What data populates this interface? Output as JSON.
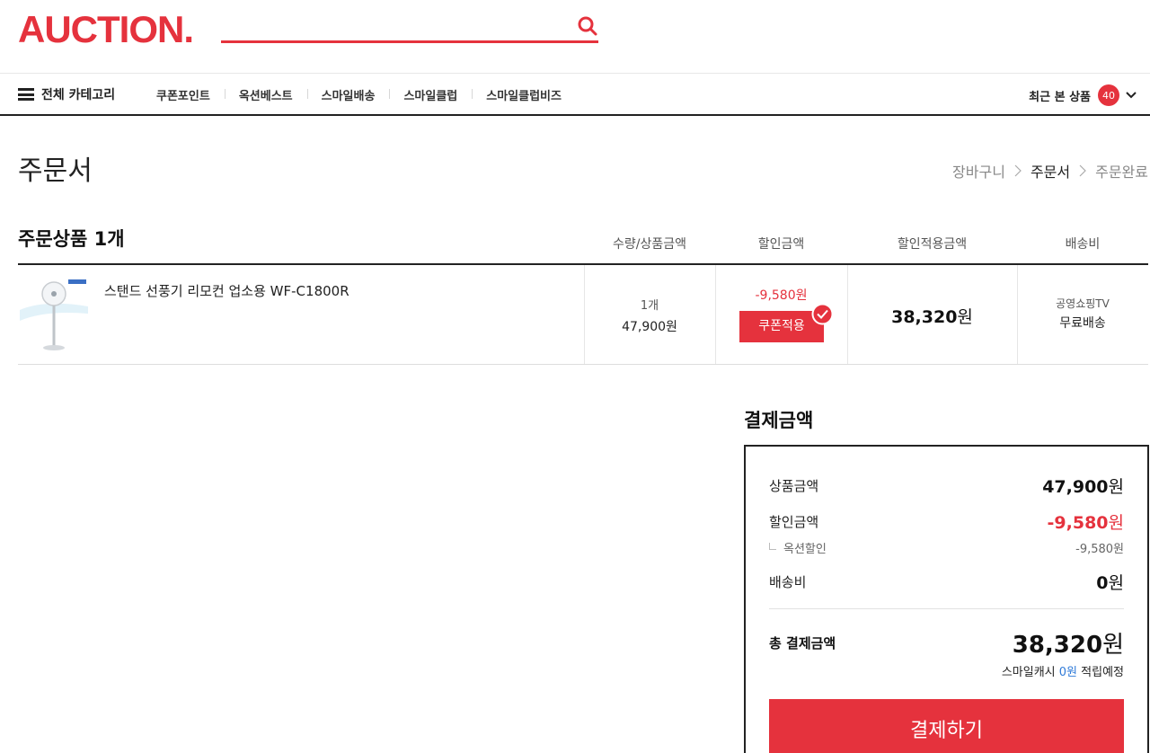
{
  "header": {
    "logo": "AUCTION.",
    "search": {
      "value": "",
      "placeholder": ""
    }
  },
  "nav": {
    "all_categories": "전체 카테고리",
    "menu": [
      "쿠폰포인트",
      "옥션베스트",
      "스마일배송",
      "스마일클럽",
      "스마일클럽비즈"
    ],
    "recent_label": "최근 본 상품",
    "recent_count": "40"
  },
  "page": {
    "title": "주문서",
    "steps": [
      "장바구니",
      "주문서",
      "주문완료"
    ],
    "active_step": "주문서"
  },
  "order": {
    "heading": "주문상품 1개",
    "columns": [
      "수량/상품금액",
      "할인금액",
      "할인적용금액",
      "배송비"
    ],
    "item": {
      "name": "스탠드 선풍기 리모컨 업소용 WF-C1800R",
      "quantity": "1개",
      "price": "47,900원",
      "discount": "-9,580원",
      "coupon_button": "쿠폰적용",
      "applied_amount": "38,320",
      "currency": "원",
      "shipping_seller": "공영쇼핑TV",
      "shipping_type": "무료배송"
    }
  },
  "payment": {
    "heading": "결제금액",
    "product_label": "상품금액",
    "product_amount": "47,900",
    "discount_label": "할인금액",
    "discount_amount": "-9,580",
    "auction_discount_label": "옥션할인",
    "auction_discount_amount": "-9,580원",
    "shipping_label": "배송비",
    "shipping_amount": "0",
    "currency": "원",
    "total_label": "총 결제금액",
    "total_amount": "38,320",
    "smile_cash_prefix": "스마일캐시",
    "smile_cash_amount": "0원",
    "smile_cash_suffix": "적립예정",
    "pay_button": "결제하기"
  },
  "colors": {
    "accent": "#e5323d",
    "link_blue": "#2f7ad8"
  }
}
